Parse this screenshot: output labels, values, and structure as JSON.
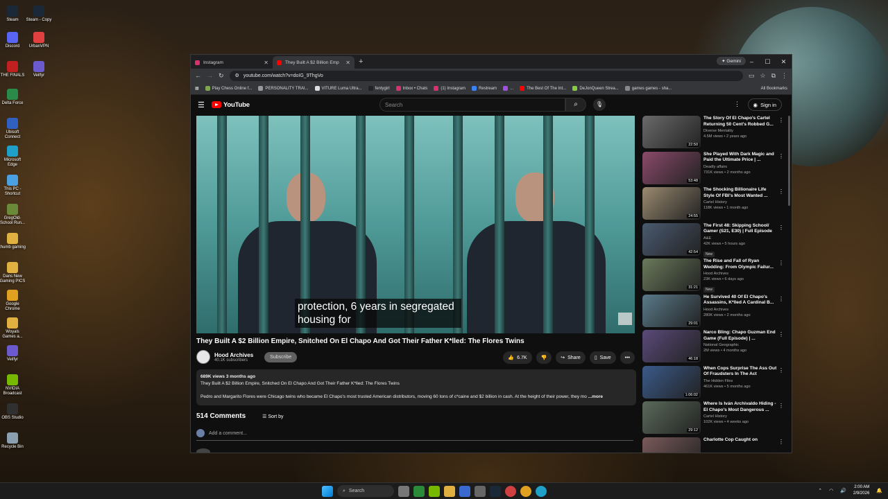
{
  "desktop": {
    "icons": [
      {
        "label": "Steam",
        "color": "#1b2838"
      },
      {
        "label": "Steam - Copy",
        "color": "#1b2838"
      },
      {
        "label": "Discord",
        "color": "#5865f2"
      },
      {
        "label": "UrbanVPN",
        "color": "#e04040"
      },
      {
        "label": "THE FINALS",
        "color": "#c02020"
      },
      {
        "label": "Veilfyr",
        "color": "#6a5acd"
      },
      {
        "label": "Delta Force",
        "color": "#2a8a4a"
      },
      {
        "label": "Ubisoft Connect",
        "color": "#3060c0"
      },
      {
        "label": "Microsoft Edge",
        "color": "#1fa0c8"
      },
      {
        "label": "This PC - Shortcut",
        "color": "#4aa0e0"
      },
      {
        "label": "GregOld-School Run...",
        "color": "#6a8a3a"
      },
      {
        "label": "thumb gaming",
        "color": "#e0b040"
      },
      {
        "label": "Dans New Gaming PICS",
        "color": "#e0b040"
      },
      {
        "label": "Google Chrome",
        "color": "#e0a020"
      },
      {
        "label": "Woyals Games a...",
        "color": "#e0b040"
      },
      {
        "label": "Veilfyr",
        "color": "#6a5acd"
      },
      {
        "label": "NVIDIA Broadcast",
        "color": "#76b900"
      },
      {
        "label": "OBS Studio",
        "color": "#303030"
      },
      {
        "label": "Recycle Bin",
        "color": "#8aa0b0"
      }
    ]
  },
  "browser": {
    "tabs": [
      {
        "title": "Instagram",
        "color": "#d6336c"
      },
      {
        "title": "They Built A $2 Billion Emp",
        "color": "#ff0000"
      }
    ],
    "gemini_label": "Gemini",
    "url": "youtube.com/watch?v=doIG_9ThgVo",
    "bookmarks": [
      {
        "label": "Play Chess Online f...",
        "color": "#7fa650"
      },
      {
        "label": "PERSONALITY TRAI...",
        "color": "#999999"
      },
      {
        "label": "VITURE Luma Ultra...",
        "color": "#dddddd"
      },
      {
        "label": "fentygirl",
        "color": "#222222"
      },
      {
        "label": "Inbox • Chats",
        "color": "#d6336c"
      },
      {
        "label": "(1) Instagram",
        "color": "#d6336c"
      },
      {
        "label": "Restream",
        "color": "#3b82f6"
      },
      {
        "label": "...",
        "color": "#a050e0"
      },
      {
        "label": "The Best Of The Int...",
        "color": "#ff0000"
      },
      {
        "label": "DeJonQueen Strea...",
        "color": "#88cc44"
      },
      {
        "label": "games games - sha...",
        "color": "#888888"
      }
    ],
    "all_bookmarks": "All Bookmarks"
  },
  "youtube": {
    "logo_text": "YouTube",
    "search_placeholder": "Search",
    "sign_in": "Sign in",
    "caption_line1": "protection, 6 years in segregated",
    "caption_line2": "housing for",
    "video_title": "They Built A $2 Billion Empire, Snitched On El Chapo And Got Their Father K*lled: The Flores Twins",
    "channel_name": "Hood Archives",
    "subscribers": "40.1K subscribers",
    "subscribe_label": "Subscribe",
    "likes": "6.7K",
    "share_label": "Share",
    "save_label": "Save",
    "description_meta": "689K views  3 months ago",
    "description_title": "They Built A $2 Billion Empire, Snitched On El Chapo And Got Their Father K*lled: The Flores Twins",
    "description_body": "Pedro and Margarito Flores were Chicago twins who became El Chapo's most trusted American distributors, moving 60 tons of c*caine and $2 billion in cash. At the height of their power, they mo",
    "more_label": "...more",
    "comment_count": "514 Comments",
    "sort_label": "Sort by",
    "add_comment": "Add a comment...",
    "recommended": [
      {
        "title": "The Story Of El Chapo's Cartel Returning 50 Cent's Robbed G...",
        "channel": "Diverse Mentality",
        "meta": "4.5M views • 2 years ago",
        "duration": "22:50",
        "color": "#6a6a6a"
      },
      {
        "title": "She Played With Dark Magic and Paid the Ultimate Price | ...",
        "channel": "Deadly affairs",
        "meta": "731K views • 2 months ago",
        "duration": "53:48",
        "color": "#8a4a6a"
      },
      {
        "title": "The Shocking Billionaire Life Style Of FBI's Most Wanted ...",
        "channel": "Cartel History",
        "meta": "118K views • 1 month ago",
        "duration": "24:55",
        "color": "#9a8a70"
      },
      {
        "title": "The First 48: Skipping School/ Gamer (S21, E30) | Full Episode",
        "channel": "A&E",
        "meta": "42K views • 5 hours ago",
        "duration": "42:54",
        "color": "#4a5a70",
        "badge": "New"
      },
      {
        "title": "The Rise and Fall of Ryan Wedding: From Olympic Failur...",
        "channel": "Hood Archives",
        "meta": "23K views • 6 days ago",
        "duration": "31:21",
        "color": "#6a7a5a",
        "badge": "New"
      },
      {
        "title": "He Survived 40 Of El Chapo's Assassins, K*lled A Cardinal B...",
        "channel": "Hood Archives",
        "meta": "280K views • 2 months ago",
        "duration": "29:01",
        "color": "#5a7a8a"
      },
      {
        "title": "Narco Bling: Chapo Guzman End Game (Full Episode) | ...",
        "channel": "National Geographic",
        "meta": "2M views • 4 months ago",
        "duration": "46:18",
        "color": "#5a4a7a"
      },
      {
        "title": "When Cops Surprise The Ass Out Of Fraudsters In The Act",
        "channel": "The Hidden Files",
        "meta": "461K views • 5 months ago",
        "duration": "1:06:02",
        "color": "#3a5a8a"
      },
      {
        "title": "Where Is Iván Archivaldo Hiding - El Chapo's Most Dangerous ...",
        "channel": "Cartel History",
        "meta": "102K views • 4 weeks ago",
        "duration": "29:12",
        "color": "#5a6a5a"
      },
      {
        "title": "Charlotte Cop Caught on",
        "channel": "",
        "meta": "",
        "duration": "",
        "color": "#7a5a5a"
      }
    ]
  },
  "taskbar": {
    "search_label": "Search",
    "time": "2:00 AM",
    "date": "2/9/2026"
  }
}
